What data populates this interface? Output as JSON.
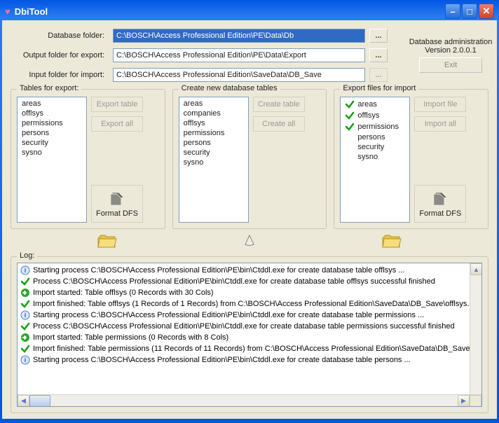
{
  "window": {
    "title": "DbiTool"
  },
  "paths": {
    "db_label": "Database folder:",
    "db_value": "C:\\BOSCH\\Access Professional Edition\\PE\\Data\\Db",
    "out_label": "Output folder for export:",
    "out_value": "C:\\BOSCH\\Access Professional Edition\\PE\\Data\\Export",
    "in_label": "Input folder for import:",
    "in_value": "C:\\BOSCH\\Access Professional Edition\\SaveData\\DB_Save",
    "browse_label": "..."
  },
  "admin": {
    "line1": "Database administration",
    "line2": "Version 2.0.0.1",
    "exit": "Exit"
  },
  "groups": {
    "export": {
      "legend": "Tables for export:",
      "items": [
        "areas",
        "offlsys",
        "permissions",
        "persons",
        "security",
        "sysno"
      ],
      "btn1": "Export table",
      "btn2": "Export all",
      "format": "Format DFS"
    },
    "create": {
      "legend": "Create new database tables",
      "items": [
        "areas",
        "companies",
        "offlsys",
        "permissions",
        "persons",
        "security",
        "sysno"
      ],
      "btn1": "Create table",
      "btn2": "Create all"
    },
    "import": {
      "legend": "Export files for import",
      "items": [
        {
          "label": "areas",
          "checked": true
        },
        {
          "label": "offlsys",
          "checked": true
        },
        {
          "label": "permissions",
          "checked": true
        },
        {
          "label": "persons",
          "checked": false
        },
        {
          "label": "security",
          "checked": false
        },
        {
          "label": "sysno",
          "checked": false
        }
      ],
      "btn1": "Import file",
      "btn2": "Import all",
      "format": "Format DFS"
    }
  },
  "log": {
    "legend": "Log:",
    "lines": [
      {
        "type": "info",
        "text": "Starting process C:\\BOSCH\\Access Professional Edition\\PE\\bin\\Ctddl.exe for create database table offlsys ..."
      },
      {
        "type": "check",
        "text": "Process C:\\BOSCH\\Access Professional Edition\\PE\\bin\\Ctddl.exe for create database table offlsys successful finished"
      },
      {
        "type": "arrow",
        "text": "Import started: Table offlsys (0 Records with 30 Cols)"
      },
      {
        "type": "check",
        "text": "Import finished: Table offlsys (1 Records of 1 Records) from C:\\BOSCH\\Access Professional Edition\\SaveData\\DB_Save\\offlsys.dfs"
      },
      {
        "type": "info",
        "text": "Starting process C:\\BOSCH\\Access Professional Edition\\PE\\bin\\Ctddl.exe for create database table permissions ..."
      },
      {
        "type": "check",
        "text": "Process C:\\BOSCH\\Access Professional Edition\\PE\\bin\\Ctddl.exe for create database table permissions successful finished"
      },
      {
        "type": "arrow",
        "text": "Import started: Table permissions (0 Records with 8 Cols)"
      },
      {
        "type": "check",
        "text": "Import finished: Table permissions (11 Records of 11 Records) from C:\\BOSCH\\Access Professional Edition\\SaveData\\DB_Save\\pe"
      },
      {
        "type": "info",
        "text": "Starting process C:\\BOSCH\\Access Professional Edition\\PE\\bin\\Ctddl.exe for create database table persons ..."
      }
    ]
  }
}
